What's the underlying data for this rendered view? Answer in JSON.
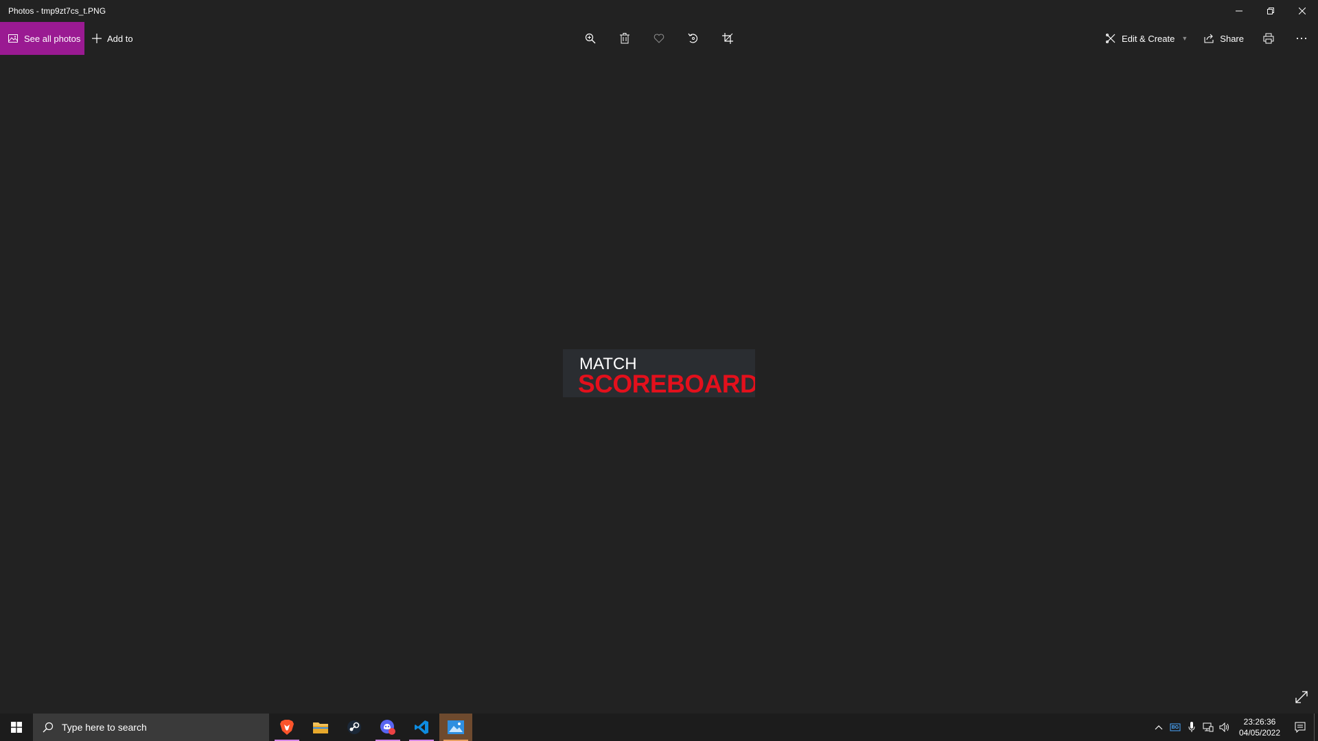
{
  "window": {
    "title": "Photos - tmp9zt7cs_t.PNG",
    "minimize_icon": "minimize-icon",
    "restore_icon": "restore-icon",
    "close_icon": "close-icon"
  },
  "toolbar": {
    "see_all_label": "See all photos",
    "add_to_label": "Add to",
    "edit_create_label": "Edit & Create",
    "share_label": "Share",
    "accent": "#9a1a92",
    "center_icons": [
      "zoom-icon",
      "delete-icon",
      "favorite-icon",
      "rotate-icon",
      "crop-icon"
    ],
    "right_icons": [
      "print-icon",
      "more-icon"
    ]
  },
  "image": {
    "line1": "MATCH",
    "line2": "SCOREBOARD",
    "line2_color": "#e3101c"
  },
  "taskbar": {
    "search_placeholder": "Type here to search",
    "apps": [
      "brave-icon",
      "file-explorer-icon",
      "steam-icon",
      "discord-icon",
      "vscode-icon",
      "photos-icon"
    ],
    "tray_lang": "BG",
    "time": "23:26:36",
    "date": "04/05/2022"
  }
}
